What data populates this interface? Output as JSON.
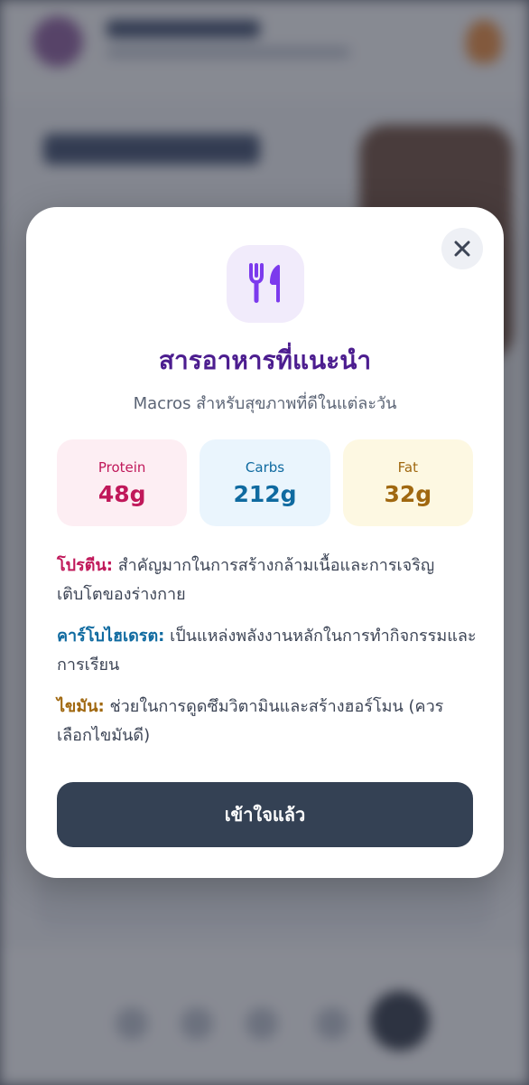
{
  "modal": {
    "title": "สารอาหารที่แนะนำ",
    "subtitle": "Macros สำหรับสุขภาพที่ดีในแต่ละวัน",
    "macros": [
      {
        "label": "Protein",
        "value": "48g",
        "color": "#c0185a",
        "bg": "#fdeef3"
      },
      {
        "label": "Carbs",
        "value": "212g",
        "color": "#0f6aa0",
        "bg": "#eaf5fd"
      },
      {
        "label": "Fat",
        "value": "32g",
        "color": "#a06810",
        "bg": "#fdf8e2"
      }
    ],
    "descriptions": [
      {
        "key": "โปรตีน:",
        "text": " สำคัญมากในการสร้างกล้ามเนื้อและการเจริญเติบโตของร่างกาย"
      },
      {
        "key": "คาร์โบไฮเดรต:",
        "text": " เป็นแหล่งพลังงานหลักในการทำกิจกรรมและการเรียน"
      },
      {
        "key": "ไขมัน:",
        "text": " ช่วยในการดูดซึมวิตามินและสร้างฮอร์โมน (ควรเลือกไขมันดี)"
      }
    ],
    "confirm_label": "เข้าใจแล้ว",
    "icon": "utensils-icon",
    "close_icon": "close-icon",
    "accent_color": "#4c1d8f",
    "button_color": "#344154"
  }
}
